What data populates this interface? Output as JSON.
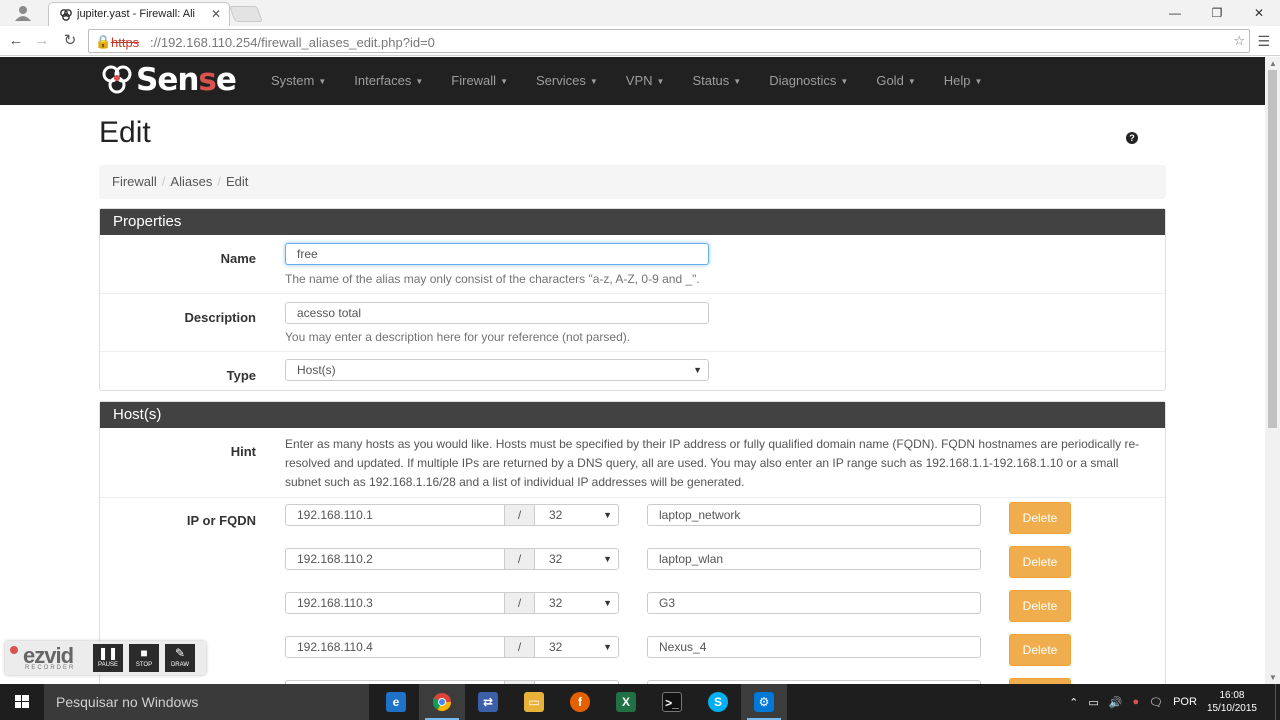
{
  "browser": {
    "tab_title": "jupiter.yast - Firewall: Ali",
    "url_scheme": "https",
    "url_rest": "://192.168.110.254/firewall_aliases_edit.php?id=0"
  },
  "navbar": {
    "logo_text_a": "Sen",
    "logo_text_b": "s",
    "logo_text_c": "e",
    "menu": [
      {
        "label": "System"
      },
      {
        "label": "Interfaces"
      },
      {
        "label": "Firewall"
      },
      {
        "label": "Services"
      },
      {
        "label": "VPN"
      },
      {
        "label": "Status"
      },
      {
        "label": "Diagnostics"
      },
      {
        "label": "Gold"
      },
      {
        "label": "Help"
      }
    ]
  },
  "page": {
    "title": "Edit",
    "breadcrumb": [
      "Firewall",
      "Aliases",
      "Edit"
    ]
  },
  "properties": {
    "heading": "Properties",
    "name_label": "Name",
    "name_value": "free",
    "name_help": "The name of the alias may only consist of the characters \"a-z, A-Z, 0-9 and _\".",
    "description_label": "Description",
    "description_value": "acesso total",
    "description_help": "You may enter a description here for your reference (not parsed).",
    "type_label": "Type",
    "type_value": "Host(s)"
  },
  "hosts": {
    "heading": "Host(s)",
    "hint_label": "Hint",
    "hint_text": "Enter as many hosts as you would like. Hosts must be specified by their IP address or fully qualified domain name (FQDN). FQDN hostnames are periodically re-resolved and updated. If multiple IPs are returned by a DNS query, all are used. You may also enter an IP range such as 192.168.1.1-192.168.1.10 or a small subnet such as 192.168.1.16/28 and a list of individual IP addresses will be generated.",
    "ip_label": "IP or FQDN",
    "slash": "/",
    "delete_label": "Delete",
    "entries": [
      {
        "ip": "192.168.110.1",
        "cidr": "32",
        "desc": "laptop_network"
      },
      {
        "ip": "192.168.110.2",
        "cidr": "32",
        "desc": "laptop_wlan"
      },
      {
        "ip": "192.168.110.3",
        "cidr": "32",
        "desc": "G3"
      },
      {
        "ip": "192.168.110.4",
        "cidr": "32",
        "desc": "Nexus_4"
      }
    ]
  },
  "recorder": {
    "logo": "ezvid",
    "sub": "RECORDER",
    "pause": "PAUSE",
    "stop": "STOP",
    "draw": "DRAW"
  },
  "taskbar": {
    "search_placeholder": "Pesquisar no Windows",
    "lang": "POR",
    "time": "16:08",
    "date": "15/10/2015"
  }
}
